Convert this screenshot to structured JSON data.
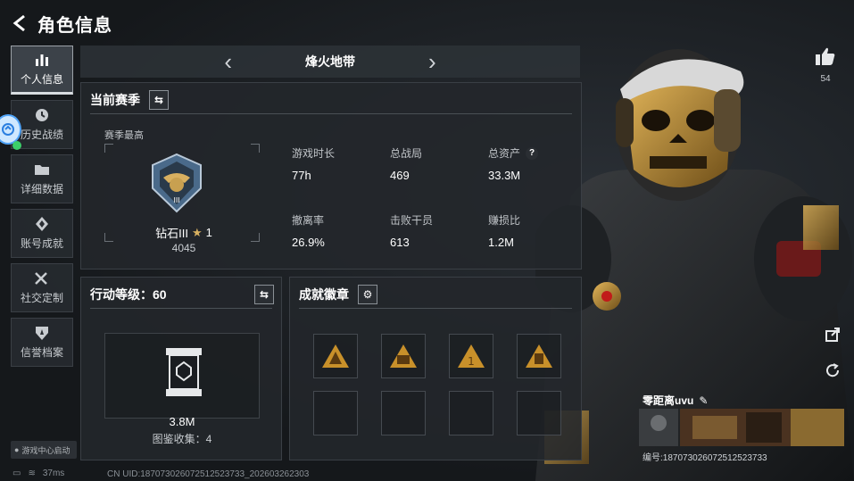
{
  "header": {
    "title": "角色信息"
  },
  "nav": {
    "items": [
      {
        "label": "个人信息",
        "icon": "bar-chart-icon",
        "active": true
      },
      {
        "label": "历史战绩",
        "icon": "clock-icon",
        "active": false
      },
      {
        "label": "详细数据",
        "icon": "folder-icon",
        "active": false
      },
      {
        "label": "账号成就",
        "icon": "diamond-badge-icon",
        "active": false
      },
      {
        "label": "社交定制",
        "icon": "tools-icon",
        "active": false
      },
      {
        "label": "信誉档案",
        "icon": "shield-icon",
        "active": false
      }
    ],
    "game_center": "游戏中心启动"
  },
  "season": {
    "name": "烽火地带"
  },
  "season_panel": {
    "title": "当前赛季",
    "peak_label": "赛季最高",
    "rank_name": "钻石III",
    "rank_stars": "1",
    "rank_score": "4045",
    "stats": [
      {
        "label": "游戏时长",
        "value": "77h"
      },
      {
        "label": "总战局",
        "value": "469"
      },
      {
        "label": "总资产",
        "value": "33.3M",
        "help": "?"
      },
      {
        "label": "撤离率",
        "value": "26.9%"
      },
      {
        "label": "击败干员",
        "value": "613"
      },
      {
        "label": "赚损比",
        "value": "1.2M"
      }
    ]
  },
  "level_panel": {
    "title": "行动等级：60",
    "collection_value": "3.8M",
    "collection_label": "图鉴收集：4"
  },
  "badge_panel": {
    "title": "成就徽章",
    "badges": [
      "badge-1-icon",
      "badge-2-icon",
      "badge-3-icon",
      "badge-4-icon",
      "",
      "",
      "",
      ""
    ]
  },
  "character": {
    "likes": "54",
    "player_name": "零距离uvu",
    "player_id": "编号:1870730260725125​23733"
  },
  "footer": {
    "ping": "37ms",
    "uid": "CN UID:1870730260725125237​33_202603262303"
  },
  "colors": {
    "accent": "#d8a23a",
    "bg": "#1a1d21"
  }
}
